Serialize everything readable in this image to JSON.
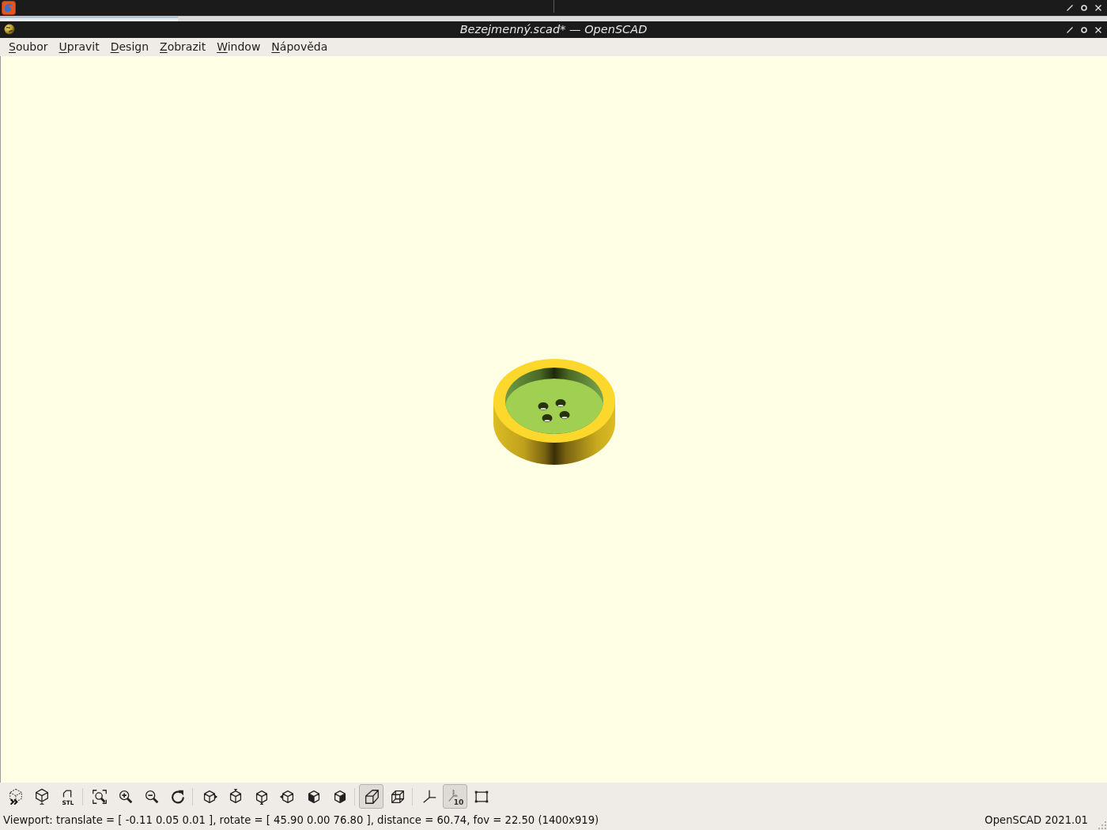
{
  "window": {
    "title": "Bezejmenný.scad* — OpenSCAD"
  },
  "menu": [
    "Soubor",
    "Upravit",
    "Design",
    "Zobrazit",
    "Window",
    "Nápověda"
  ],
  "toolbar": {
    "groups": [
      {
        "buttons": [
          {
            "pressed": false,
            "disabled": false
          },
          {
            "pressed": false,
            "disabled": false
          },
          {
            "pressed": false,
            "disabled": false,
            "text": "STL"
          }
        ]
      },
      {
        "buttons": [
          {
            "pressed": false,
            "disabled": false
          },
          {
            "pressed": false,
            "disabled": false
          },
          {
            "pressed": false,
            "disabled": false
          },
          {
            "pressed": false,
            "disabled": false
          }
        ]
      },
      {
        "buttons": [
          {
            "pressed": false,
            "disabled": false
          },
          {
            "pressed": false,
            "disabled": false
          },
          {
            "pressed": false,
            "disabled": false
          },
          {
            "pressed": false,
            "disabled": false
          },
          {
            "pressed": false,
            "disabled": false
          },
          {
            "pressed": false,
            "disabled": false
          }
        ]
      },
      {
        "buttons": [
          {
            "pressed": true,
            "disabled": false
          },
          {
            "pressed": false,
            "disabled": false
          }
        ]
      },
      {
        "buttons": [
          {
            "pressed": false,
            "disabled": false
          },
          {
            "pressed": true,
            "disabled": true,
            "text": "10"
          },
          {
            "pressed": false,
            "disabled": false
          }
        ]
      }
    ]
  },
  "status_bar": {
    "viewport_info": "Viewport: translate = [ -0.11 0.05 0.01 ], rotate = [ 45.90 0.00 76.80 ], distance = 60.74, fov = 22.50 (1400x919)",
    "version": "OpenSCAD 2021.01"
  }
}
